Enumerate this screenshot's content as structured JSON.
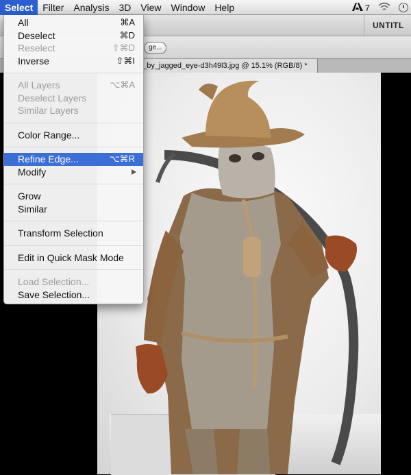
{
  "menubar": {
    "items": [
      {
        "label": "Select",
        "active": true
      },
      {
        "label": "Filter"
      },
      {
        "label": "Analysis"
      },
      {
        "label": "3D"
      },
      {
        "label": "View"
      },
      {
        "label": "Window"
      },
      {
        "label": "Help"
      }
    ],
    "tray": {
      "adobe_icon": "adobe-icon",
      "adobe_badge": "7",
      "wifi_icon": "wifi-icon",
      "clock_icon": "clock-icon"
    }
  },
  "app": {
    "workspace_label": "UNTITL",
    "refine_button_label": "ge...",
    "document_tab": "a_by_jagged_eye-d3h49l3.jpg @ 15.1% (RGB/8) *"
  },
  "menu": {
    "groups": [
      [
        {
          "label": "All",
          "shortcut": "⌘A"
        },
        {
          "label": "Deselect",
          "shortcut": "⌘D"
        },
        {
          "label": "Reselect",
          "shortcut": "⇧⌘D",
          "disabled": true
        },
        {
          "label": "Inverse",
          "shortcut": "⇧⌘I"
        }
      ],
      [
        {
          "label": "All Layers",
          "shortcut": "⌥⌘A",
          "disabled": true
        },
        {
          "label": "Deselect Layers",
          "disabled": true
        },
        {
          "label": "Similar Layers",
          "disabled": true
        }
      ],
      [
        {
          "label": "Color Range..."
        }
      ],
      [
        {
          "label": "Refine Edge...",
          "shortcut": "⌥⌘R",
          "highlighted": true
        },
        {
          "label": "Modify",
          "submenu": true
        }
      ],
      [
        {
          "label": "Grow"
        },
        {
          "label": "Similar"
        }
      ],
      [
        {
          "label": "Transform Selection"
        }
      ],
      [
        {
          "label": "Edit in Quick Mask Mode"
        }
      ],
      [
        {
          "label": "Load Selection...",
          "disabled": true
        },
        {
          "label": "Save Selection..."
        }
      ]
    ]
  },
  "colors": {
    "menu_highlight": "#3b6fd6",
    "menubar_active": "#2d5fd0",
    "disabled_text": "#9c9c9c"
  }
}
